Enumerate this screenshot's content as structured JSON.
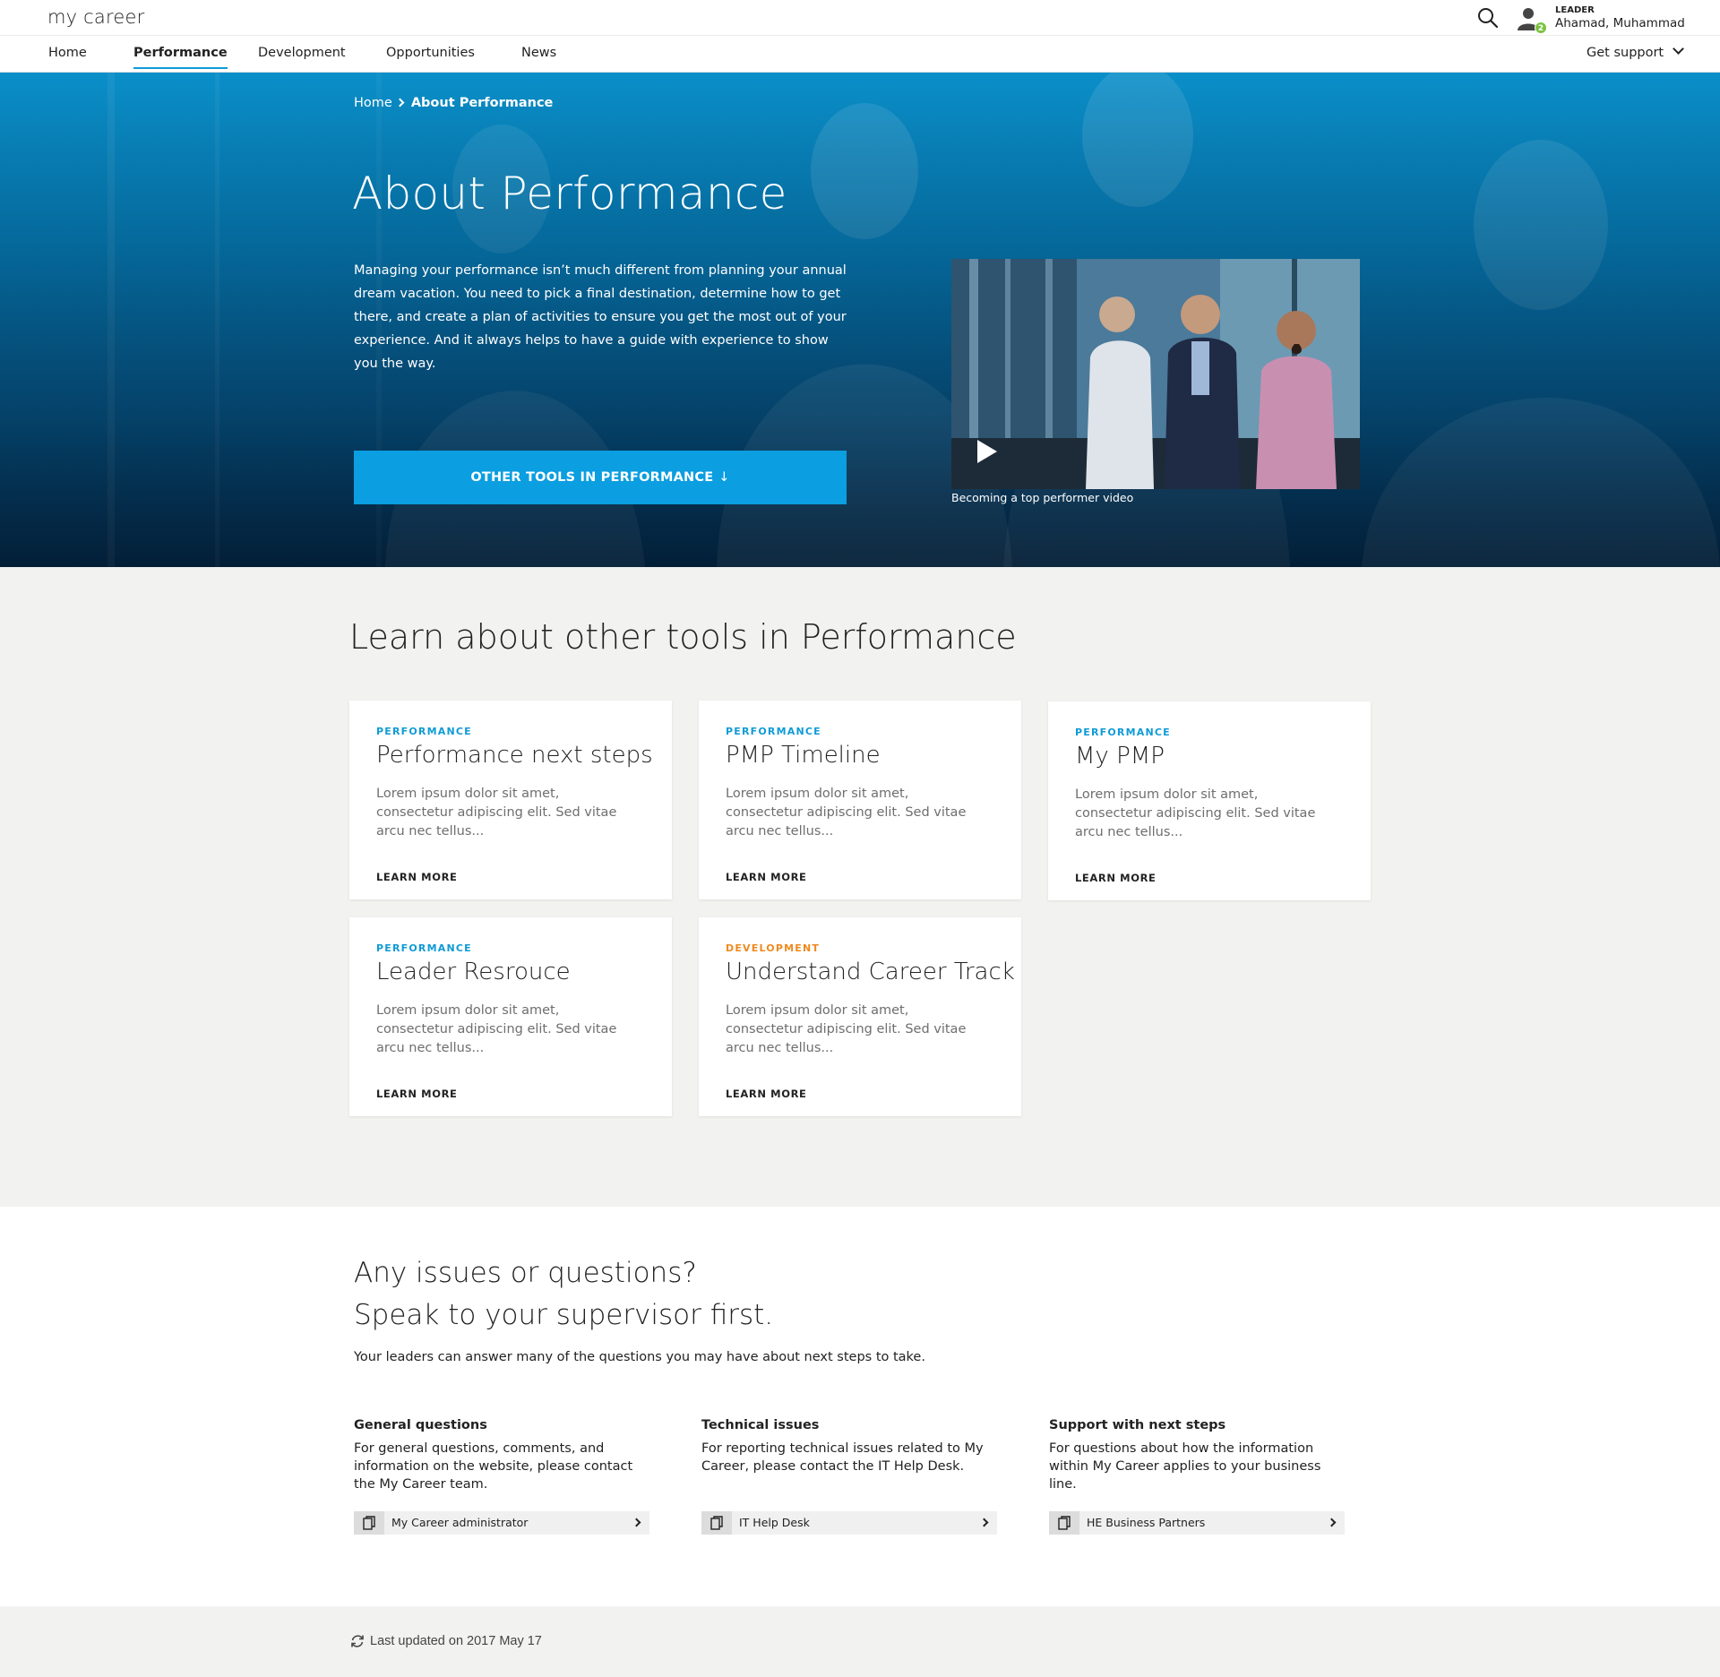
{
  "app": {
    "logo": "my career",
    "user": {
      "role": "LEADER",
      "name": "Ahamad, Muhammad",
      "notification_count": "2"
    }
  },
  "nav": {
    "items": [
      {
        "label": "Home"
      },
      {
        "label": "Performance",
        "active": true
      },
      {
        "label": "Development"
      },
      {
        "label": "Opportunities"
      },
      {
        "label": "News"
      }
    ],
    "support_label": "Get support"
  },
  "hero": {
    "breadcrumb": {
      "home": "Home",
      "current": "About Performance"
    },
    "title": "About Performance",
    "description": "Managing your performance isn’t much different from planning your annual dream vacation. You need to pick a final destination, determine how to get there, and create a plan of activities to ensure you get the most out of your experience. And it always helps to have a guide with experience to show you the way.",
    "cta_label": "OTHER TOOLS IN PERFORMANCE",
    "cta_arrow": "↓",
    "video_caption": "Becoming a top performer video"
  },
  "tools": {
    "title": "Learn about other tools in Performance",
    "cards": [
      {
        "category": "PERFORMANCE",
        "title": "Performance next steps",
        "description": "Lorem ipsum dolor sit amet, consectetur adipiscing elit. Sed vitae arcu nec tellus...",
        "link": "LEARN MORE"
      },
      {
        "category": "PERFORMANCE",
        "title": "PMP Timeline",
        "description": "Lorem ipsum dolor sit amet, consectetur adipiscing elit. Sed vitae arcu nec tellus...",
        "link": "LEARN MORE"
      },
      {
        "category": "PERFORMANCE",
        "title": "My PMP",
        "description": "Lorem ipsum dolor sit amet, consectetur adipiscing elit. Sed vitae arcu nec tellus...",
        "link": "LEARN MORE"
      },
      {
        "category": "PERFORMANCE",
        "title": "Leader Resrouce",
        "description": "Lorem ipsum dolor sit amet, consectetur adipiscing elit. Sed vitae arcu nec tellus...",
        "link": "LEARN MORE"
      },
      {
        "category": "DEVELOPMENT",
        "title": "Understand Career Track",
        "description": "Lorem ipsum dolor sit amet, consectetur adipiscing elit. Sed vitae arcu nec tellus...",
        "link": "LEARN MORE"
      }
    ]
  },
  "support": {
    "heading_line1": "Any issues or questions?",
    "heading_line2": "Speak to your supervisor first.",
    "intro": "Your leaders can answer many of the questions you may have about next steps to take.",
    "columns": [
      {
        "heading": "General questions",
        "text": "For general questions, comments, and information on the website, please contact the My Career team.",
        "link": "My Career administrator"
      },
      {
        "heading": "Technical issues",
        "text": "For reporting technical issues related to My Career, please contact the IT Help Desk.",
        "link": "IT Help Desk"
      },
      {
        "heading": "Support with next steps",
        "text": "For questions about how the information within My Career applies to your business line.",
        "link": "HE Business Partners"
      }
    ]
  },
  "footer": {
    "last_updated": "Last updated on 2017 May 17"
  },
  "colors": {
    "accent": "#0f9bd7",
    "cta": "#0b9ee0",
    "development": "#ef8a1f",
    "badge": "#7cc242",
    "section_bg": "#f2f2f1"
  }
}
